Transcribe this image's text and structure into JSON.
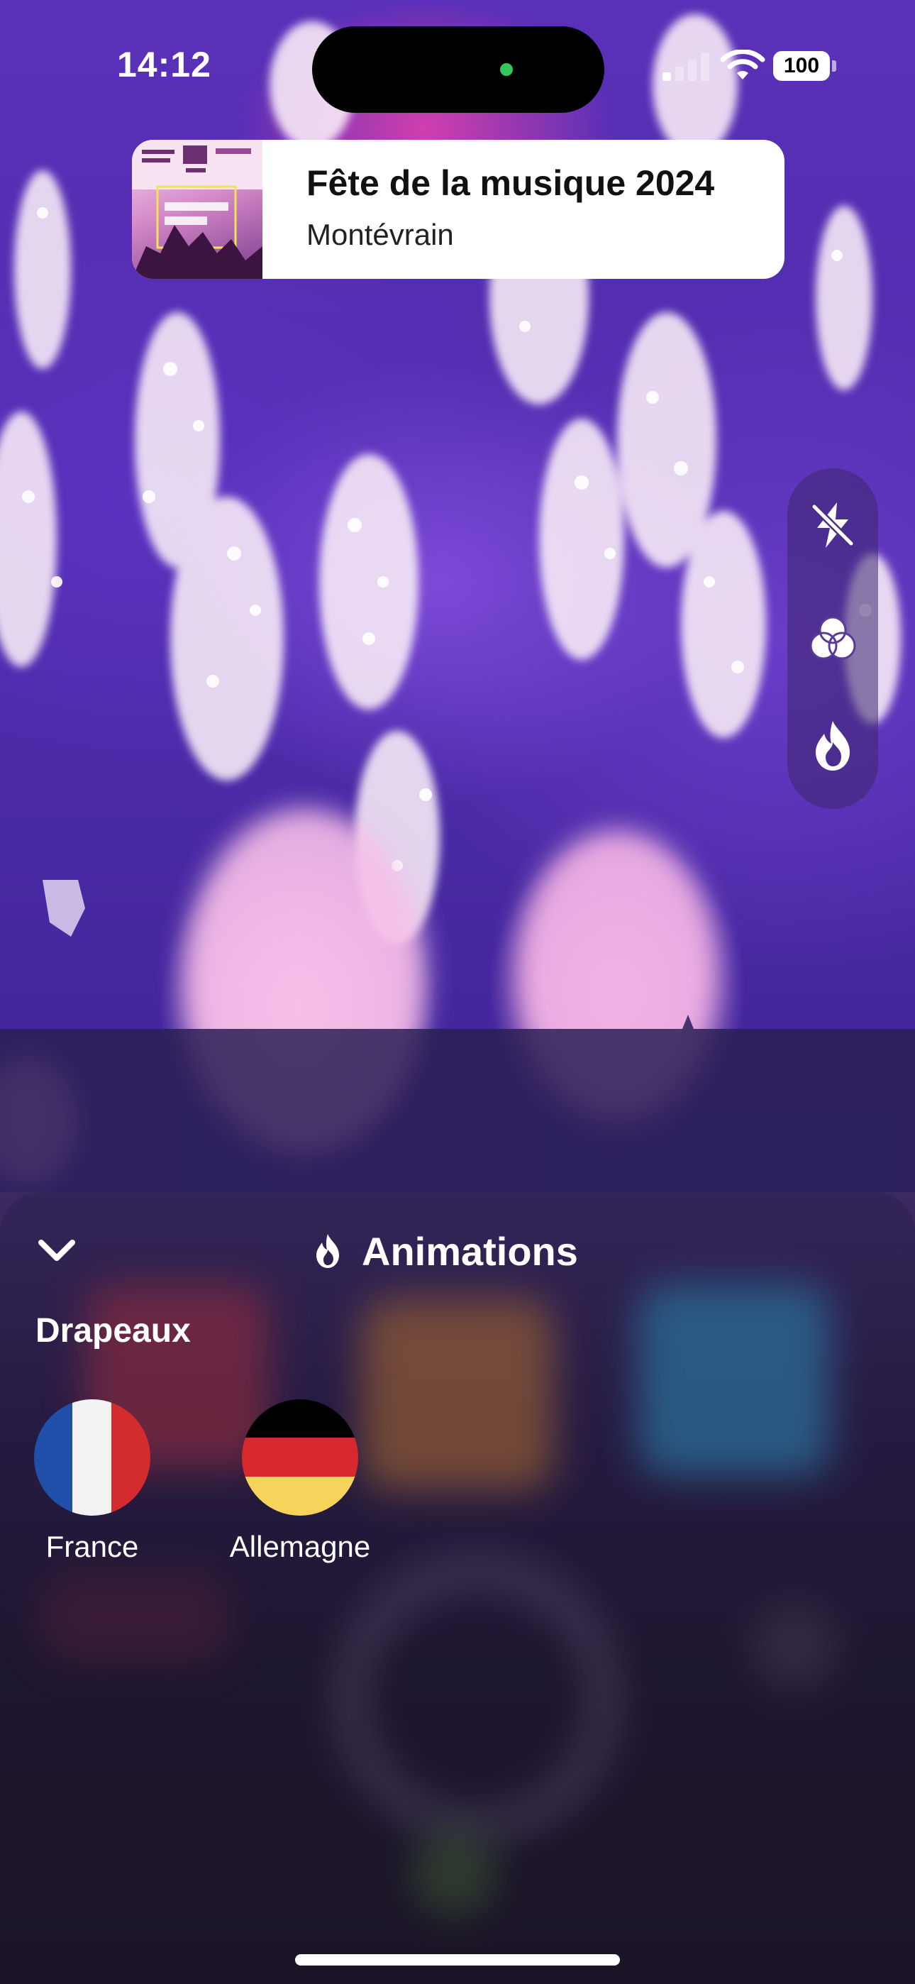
{
  "status_bar": {
    "time": "14:12",
    "battery": "100"
  },
  "event_card": {
    "title": "Fête de la musique 2024",
    "location": "Montévrain"
  },
  "right_controls": {
    "icons": [
      "flash-off-icon",
      "color-filter-icon",
      "flame-icon"
    ]
  },
  "animations_sheet": {
    "title": "Animations",
    "section_title": "Drapeaux",
    "flags": [
      {
        "label": "France",
        "colors": [
          "#1f4fa8",
          "#f2f2f2",
          "#d42b2f"
        ]
      },
      {
        "label": "Allemagne",
        "colors": [
          "#000000",
          "#d9272e",
          "#f6d35b"
        ]
      }
    ]
  },
  "colors": {
    "sheet_text": "#ffffff",
    "background_purple": "#4a2aa6"
  }
}
